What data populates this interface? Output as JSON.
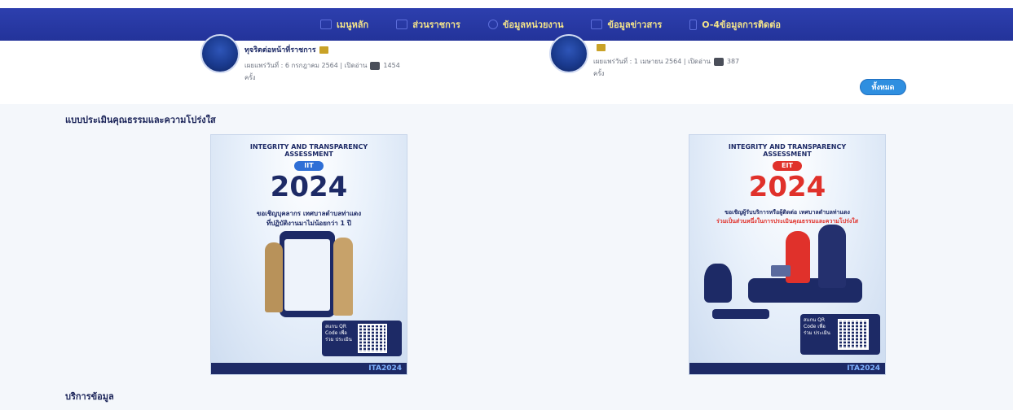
{
  "page": {
    "cut_heading": ""
  },
  "nav": {
    "items": [
      {
        "label": "เมนูหลัก",
        "icon": "grid-icon"
      },
      {
        "label": "ส่วนราชการ",
        "icon": "building-icon"
      },
      {
        "label": "ข้อมูลหน่วยงาน",
        "icon": "info-icon"
      },
      {
        "label": "ข้อมูลข่าวสาร",
        "icon": "news-icon"
      },
      {
        "label": "O-4ข้อมูลการติดต่อ",
        "icon": "phone-icon"
      }
    ]
  },
  "news": [
    {
      "title": "ทุจริตต่อหน้าที่ราชการ",
      "meta": "เผยแพร่วันที่ : 6 กรกฎาคม 2564 | เปิดอ่าน",
      "views": "1454",
      "unit": "ครั้ง"
    },
    {
      "title": "",
      "meta": "เผยแพร่วันที่ : 1 เมษายน 2564 | เปิดอ่าน",
      "views": "387",
      "unit": "ครั้ง"
    }
  ],
  "all_button": "ทั้งหมด",
  "sections": {
    "ita_title": "แบบประเมินคุณธรรมและความโปร่งใส",
    "service_title": "บริการข้อมูล"
  },
  "posters": [
    {
      "header": "INTEGRITY AND TRANSPARENCY ASSESSMENT",
      "badge": "IIT",
      "year": "2024",
      "line1": "ขอเชิญบุคลากร เทศบาลตำบลท่าแดง",
      "line2": "ที่ปฏิบัติงานมาไม่น้อยกว่า 1 ปี",
      "qr_label": "สแกน QR Code เพื่อร่วม ประเมิน",
      "tag": "ITA2024",
      "year_color": "#1d2a66",
      "badge_color": "#2f6fd6"
    },
    {
      "header": "INTEGRITY AND TRANSPARENCY ASSESSMENT",
      "badge": "EIT",
      "year": "2024",
      "line1": "ขอเชิญผู้รับบริการหรือผู้ติดต่อ เทศบาลตำบลท่าแดง",
      "line2": "ร่วมเป็นส่วนหนึ่งในการประเมินคุณธรรมและความโปร่งใส",
      "qr_label": "สแกน QR Code เพื่อร่วม ประเมิน",
      "tag": "ITA2024",
      "year_color": "#e0312b",
      "badge_color": "#e0312b"
    }
  ]
}
